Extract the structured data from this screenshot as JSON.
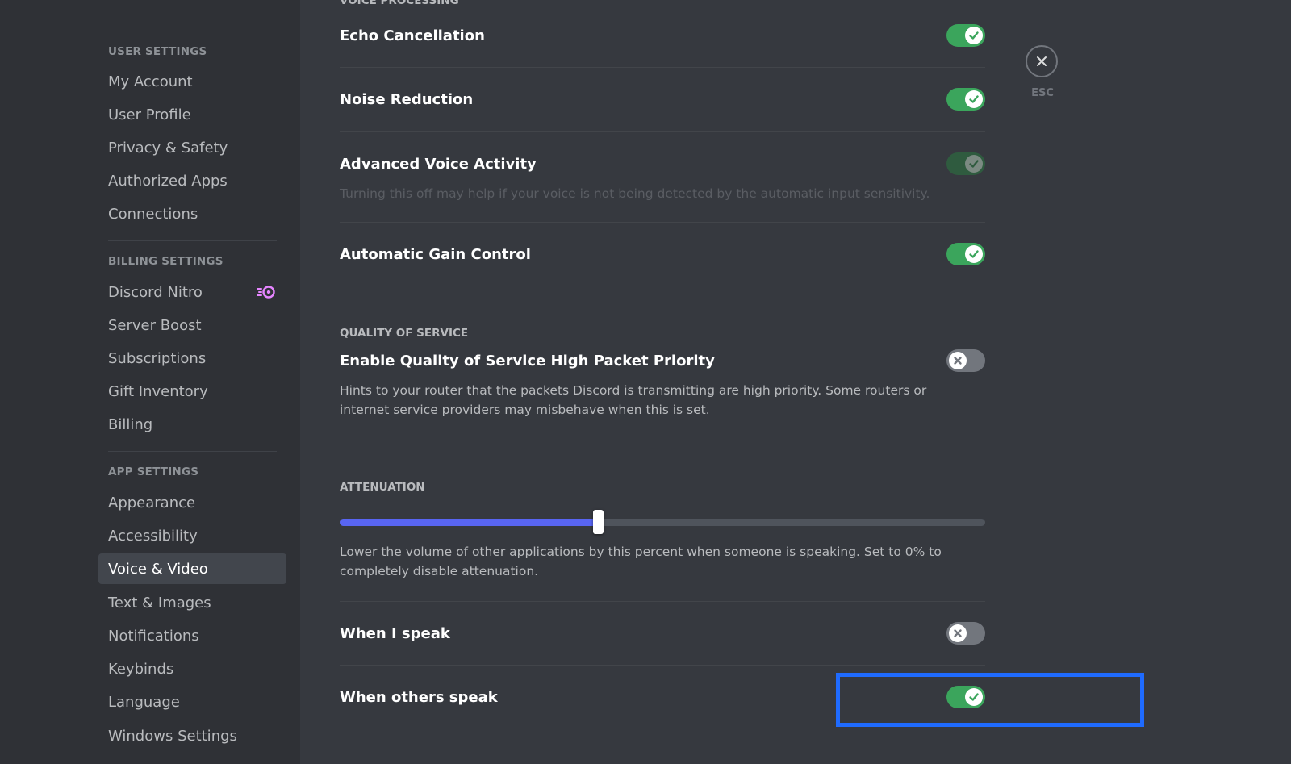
{
  "sidebar": {
    "user_settings_header": "User Settings",
    "user_items": [
      "My Account",
      "User Profile",
      "Privacy & Safety",
      "Authorized Apps",
      "Connections"
    ],
    "billing_header": "Billing Settings",
    "billing_items": [
      "Discord Nitro",
      "Server Boost",
      "Subscriptions",
      "Gift Inventory",
      "Billing"
    ],
    "app_header": "App Settings",
    "app_items": [
      "Appearance",
      "Accessibility",
      "Voice & Video",
      "Text & Images",
      "Notifications",
      "Keybinds",
      "Language",
      "Windows Settings"
    ],
    "active_item": "Voice & Video"
  },
  "main": {
    "voice_processing_header": "Voice Processing",
    "echo_cancellation": {
      "label": "Echo Cancellation",
      "state": "on"
    },
    "noise_reduction": {
      "label": "Noise Reduction",
      "state": "on"
    },
    "advanced_voice_activity": {
      "label": "Advanced Voice Activity",
      "description": "Turning this off may help if your voice is not being detected by the automatic input sensitivity.",
      "state": "on-disabled"
    },
    "automatic_gain_control": {
      "label": "Automatic Gain Control",
      "state": "on"
    },
    "qos_header": "Quality of Service",
    "qos": {
      "label": "Enable Quality of Service High Packet Priority",
      "description": "Hints to your router that the packets Discord is transmitting are high priority. Some routers or internet service providers may misbehave when this is set.",
      "state": "off"
    },
    "attenuation_header": "Attenuation",
    "attenuation_value_fraction": 0.4,
    "attenuation_description": "Lower the volume of other applications by this percent when someone is speaking. Set to 0% to completely disable attenuation.",
    "when_i_speak": {
      "label": "When I speak",
      "state": "off"
    },
    "when_others_speak": {
      "label": "When others speak",
      "state": "on"
    }
  },
  "close": {
    "label": "ESC"
  },
  "colors": {
    "toggle_on": "#3ba55c",
    "toggle_off": "#72767d",
    "slider_fill": "#5865f2",
    "highlight": "#1f6bff"
  }
}
